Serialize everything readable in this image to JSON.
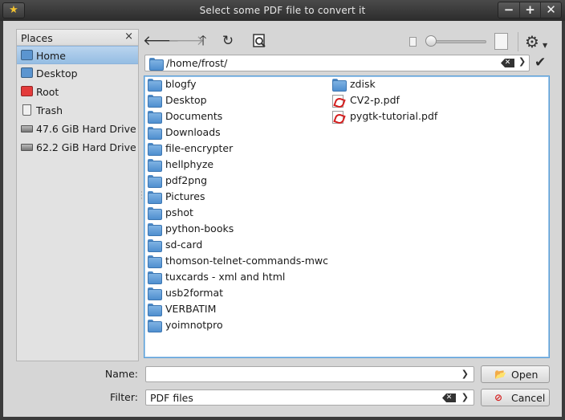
{
  "window": {
    "title": "Select some PDF file to convert it",
    "buttons": [
      "−",
      "+",
      "✕"
    ]
  },
  "places": {
    "header": "Places",
    "items": [
      {
        "label": "Home",
        "icon": "home-folder-icon",
        "color": "#5b95d0",
        "selected": true
      },
      {
        "label": "Desktop",
        "icon": "folder-icon",
        "color": "#5b95d0",
        "selected": false
      },
      {
        "label": "Root",
        "icon": "folder-icon",
        "color": "#e33b3b",
        "selected": false
      },
      {
        "label": "Trash",
        "icon": "trash-icon",
        "color": "#888888",
        "selected": false
      },
      {
        "label": "47.6 GiB Hard Drive",
        "icon": "hard-drive-icon",
        "color": "#777777",
        "selected": false
      },
      {
        "label": "62.2 GiB Hard Drive",
        "icon": "hard-drive-icon",
        "color": "#777777",
        "selected": false
      }
    ]
  },
  "toolbar": {
    "back": "🡐",
    "forward": "🡒",
    "up": "🡑",
    "refresh": "↻",
    "zoom_level": 0.0
  },
  "path": {
    "value": "/home/frost/"
  },
  "files": {
    "column1": [
      {
        "name": "blogfy",
        "type": "folder"
      },
      {
        "name": "Desktop",
        "type": "folder"
      },
      {
        "name": "Documents",
        "type": "folder"
      },
      {
        "name": "Downloads",
        "type": "folder"
      },
      {
        "name": "file-encrypter",
        "type": "folder"
      },
      {
        "name": "hellphyze",
        "type": "folder"
      },
      {
        "name": "pdf2png",
        "type": "folder"
      },
      {
        "name": "Pictures",
        "type": "folder"
      },
      {
        "name": "pshot",
        "type": "folder"
      },
      {
        "name": "python-books",
        "type": "folder"
      },
      {
        "name": "sd-card",
        "type": "folder"
      },
      {
        "name": "thomson-telnet-commands-mwc",
        "type": "folder"
      },
      {
        "name": "tuxcards - xml and html",
        "type": "folder"
      },
      {
        "name": "usb2format",
        "type": "folder"
      },
      {
        "name": "VERBATIM",
        "type": "folder"
      },
      {
        "name": "yoimnotpro",
        "type": "folder"
      }
    ],
    "column2": [
      {
        "name": "zdisk",
        "type": "folder"
      },
      {
        "name": "CV2-p.pdf",
        "type": "pdf"
      },
      {
        "name": "pygtk-tutorial.pdf",
        "type": "pdf"
      }
    ]
  },
  "name_row": {
    "label": "Name:",
    "value": ""
  },
  "filter_row": {
    "label": "Filter:",
    "value": "PDF files"
  },
  "buttons": {
    "open": "Open",
    "cancel": "Cancel"
  }
}
